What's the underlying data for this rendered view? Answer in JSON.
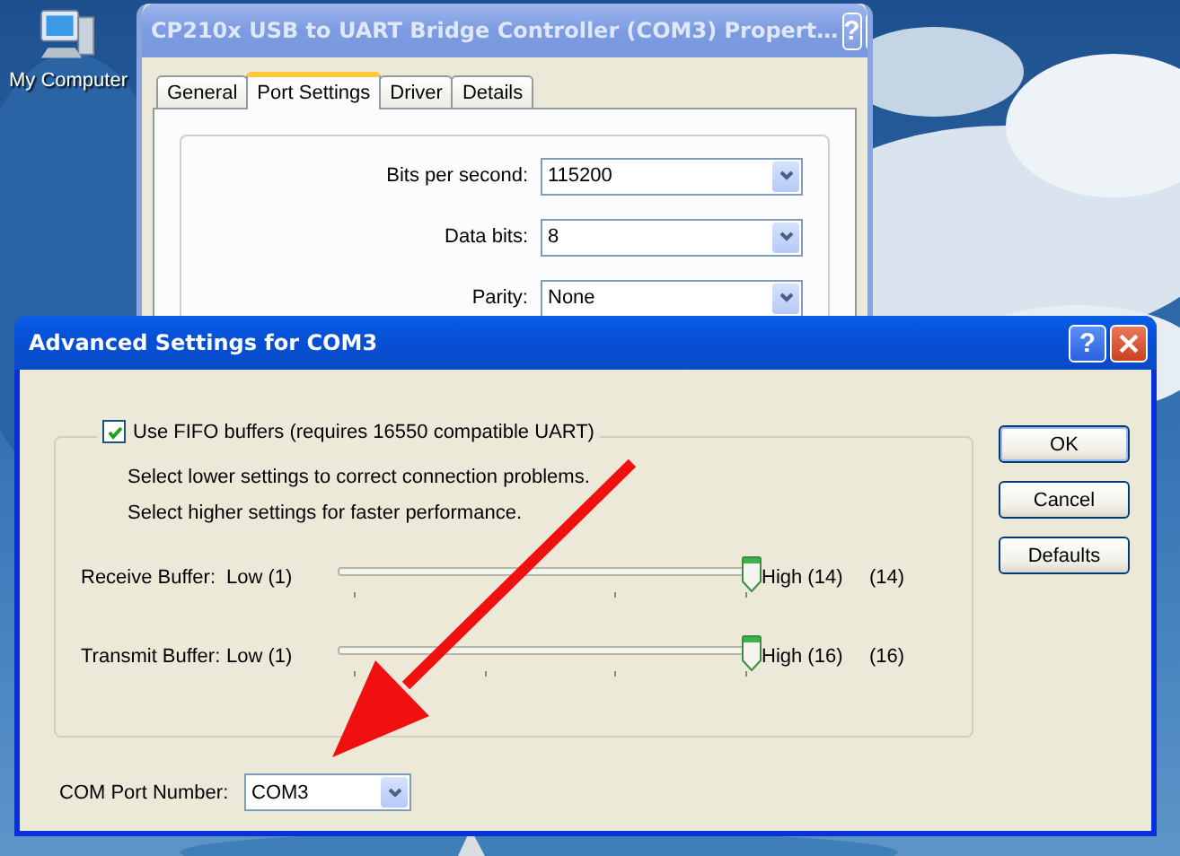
{
  "desktop_icons": [
    {
      "label": "My Computer"
    }
  ],
  "properties_window": {
    "title": "CP210x USB to UART Bridge Controller (COM3) Propert…",
    "active": false,
    "help_button": "?",
    "tabs": [
      {
        "label": "General",
        "selected": false
      },
      {
        "label": "Port Settings",
        "selected": true
      },
      {
        "label": "Driver",
        "selected": false
      },
      {
        "label": "Details",
        "selected": false
      }
    ],
    "fields": [
      {
        "label": "Bits per second:",
        "value": "115200"
      },
      {
        "label": "Data bits:",
        "value": "8"
      },
      {
        "label": "Parity:",
        "value": "None"
      }
    ]
  },
  "advanced_dialog": {
    "title": "Advanced Settings for COM3",
    "active": true,
    "help_button": "?",
    "fifo": {
      "label": "Use FIFO buffers (requires 16550 compatible UART)",
      "checked": true
    },
    "notes": [
      "Select lower settings to correct connection problems.",
      "Select higher settings for faster performance."
    ],
    "sliders": [
      {
        "label": "Receive Buffer:",
        "low": "Low (1)",
        "high": "High (14)",
        "reading": "(14)",
        "level": 1
      },
      {
        "label": "Transmit Buffer:",
        "low": "Low (1)",
        "high": "High (16)",
        "reading": "(16)",
        "level": 1
      }
    ],
    "com_port": {
      "label": "COM Port Number:",
      "value": "COM3"
    },
    "buttons": [
      "OK",
      "Cancel",
      "Defaults"
    ]
  },
  "annotation": {
    "kind": "arrow"
  }
}
